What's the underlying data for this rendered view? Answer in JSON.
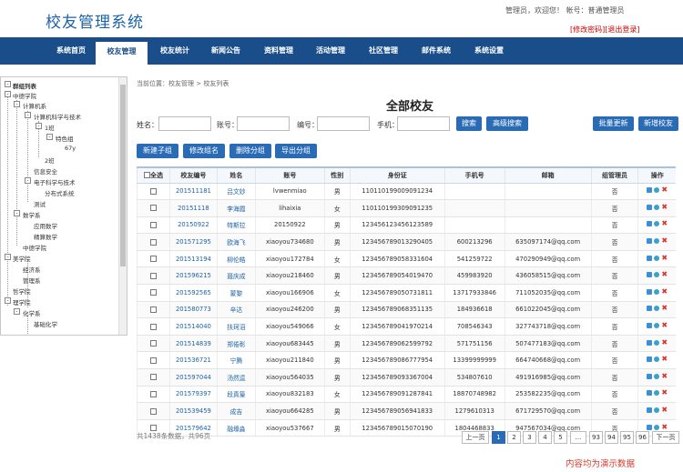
{
  "header": {
    "logo": "校友管理系统",
    "userinfo": "管理员，欢迎您！ 帐号：普通管理员",
    "change_pwd": "[修改密码]",
    "logout": "[退出登录]"
  },
  "nav": [
    {
      "label": "系统首页"
    },
    {
      "label": "校友管理"
    },
    {
      "label": "校友统计"
    },
    {
      "label": "新闻公告"
    },
    {
      "label": "资料管理"
    },
    {
      "label": "活动管理"
    },
    {
      "label": "社区管理"
    },
    {
      "label": "邮件系统"
    },
    {
      "label": "系统设置"
    }
  ],
  "tree": [
    "群组列表",
    "中德学院",
    "计算机系",
    "计算机科学与技术",
    "1班",
    "特色组",
    "67y",
    "2班",
    "信息安全",
    "电子科学与技术",
    "分布式系统",
    "测试",
    "数学系",
    "应用数学",
    "精算数学",
    "中德学院",
    "美学院",
    "经济系",
    "管理系",
    "哲学院",
    "理学院",
    "化学系",
    "基础化学"
  ],
  "breadcrumb": "当前位置：校友管理 > 校友列表",
  "title": "全部校友",
  "filters": {
    "name": "姓名：",
    "account": "账号：",
    "number": "编号：",
    "phone": "手机："
  },
  "buttons": {
    "search": "搜索",
    "advanced": "高级搜索",
    "batch_update": "批量更新",
    "add_alumni": "新增校友",
    "new_group": "新建子组",
    "rename_group": "修改组名",
    "delete_group": "删除分组",
    "export_group": "导出分组"
  },
  "table": {
    "headers": [
      "全选",
      "校友编号",
      "姓名",
      "账号",
      "性别",
      "身份证",
      "手机号",
      "邮箱",
      "组管理员",
      "操作"
    ],
    "rows": [
      [
        "201511181",
        "吕文妙",
        "lvwenmiao",
        "男",
        "110110199009091234",
        "",
        "",
        "否"
      ],
      [
        "20151118",
        "李海霞",
        "lihaixia",
        "女",
        "110110199309091235",
        "",
        "",
        "否"
      ],
      [
        "20150922",
        "特斯拉",
        "20150922",
        "男",
        "123456123456123589",
        "",
        "",
        "否"
      ],
      [
        "201571295",
        "欧海飞",
        "xiaoyou734680",
        "男",
        "123456789013290405",
        "600213296",
        "635097174@qq.com",
        "否"
      ],
      [
        "201513194",
        "柳伦皓",
        "xiaoyou172784",
        "女",
        "123456789058331604",
        "541259722",
        "470290949@qq.com",
        "否"
      ],
      [
        "201596215",
        "聂庆成",
        "xiaoyou218460",
        "男",
        "123456789054019470",
        "459983920",
        "436058515@qq.com",
        "否"
      ],
      [
        "201592565",
        "蒙黎",
        "xiaoyou166906",
        "女",
        "123456789050731811",
        "13717933846",
        "711052035@qq.com",
        "否"
      ],
      [
        "201580773",
        "辛达",
        "xiaoyou246200",
        "男",
        "123456789068351135",
        "184936618",
        "661022045@qq.com",
        "否"
      ],
      [
        "201514040",
        "扶珂滔",
        "xiaoyou549066",
        "女",
        "123456789041970214",
        "708546343",
        "327743718@qq.com",
        "否"
      ],
      [
        "201514839",
        "郑倦彰",
        "xiaoyou683445",
        "男",
        "123456789062599792",
        "571751156",
        "507477183@qq.com",
        "否"
      ],
      [
        "201536721",
        "宁腾",
        "xiaoyou211840",
        "男",
        "123456789086777954",
        "13399999999",
        "664740668@qq.com",
        "否"
      ],
      [
        "201597044",
        "汤然逵",
        "xiaoyou564035",
        "男",
        "123456789093367004",
        "534807610",
        "491916985@qq.com",
        "否"
      ],
      [
        "201579397",
        "段真篁",
        "xiaoyou832183",
        "女",
        "123456789091287841",
        "18870748982",
        "253582235@qq.com",
        "否"
      ],
      [
        "201539459",
        "成吉",
        "xiaoyou664285",
        "男",
        "123456789056941833",
        "1279610313",
        "671729570@qq.com",
        "否"
      ],
      [
        "201579642",
        "融壕淼",
        "xiaoyou537667",
        "男",
        "123456789015070190",
        "1804468833",
        "947567034@qq.com",
        "否"
      ]
    ]
  },
  "footer": {
    "total": "共1438条数据，共96页",
    "pages": [
      "上一页",
      "1",
      "2",
      "3",
      "4",
      "5",
      "...",
      "93",
      "94",
      "95",
      "96",
      "下一页"
    ],
    "demo_note": "内容均为演示数据"
  }
}
